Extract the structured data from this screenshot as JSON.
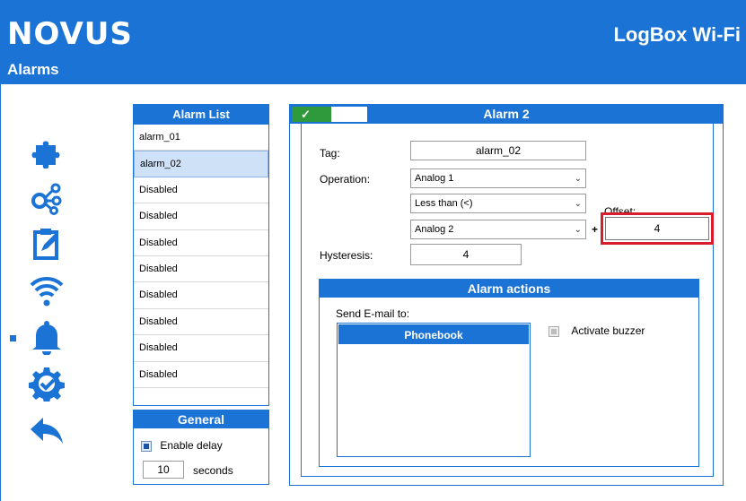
{
  "header": {
    "logo": "NOVUS",
    "product": "LogBox Wi-Fi",
    "page_title": "Alarms"
  },
  "nav": {
    "icons": [
      "puzzle-icon",
      "network-icon",
      "clipboard-icon",
      "wifi-icon",
      "bell-icon",
      "settings-check-icon",
      "back-arrow-icon"
    ],
    "active": "bell-icon",
    "accent": "#1b73d6"
  },
  "alarm_list": {
    "title": "Alarm  List",
    "items": [
      {
        "label": "alarm_01"
      },
      {
        "label": "alarm_02",
        "selected": true
      },
      {
        "label": "Disabled"
      },
      {
        "label": "Disabled"
      },
      {
        "label": "Disabled"
      },
      {
        "label": "Disabled"
      },
      {
        "label": "Disabled"
      },
      {
        "label": "Disabled"
      },
      {
        "label": "Disabled"
      },
      {
        "label": "Disabled"
      }
    ]
  },
  "general": {
    "title": "General",
    "enable_delay_label": "Enable delay",
    "delay_value": "10",
    "delay_unit": "seconds"
  },
  "alarm": {
    "title": "Alarm  2",
    "enabled_mark": "✓",
    "tag_label": "Tag:",
    "tag_value": "alarm_02",
    "operation_label": "Operation:",
    "operation_value": "Analog 1",
    "comparison_value": "Less than (<)",
    "compare_with_value": "Analog 2",
    "plus": "+",
    "offset_label": "Offset:",
    "offset_value": "4",
    "hysteresis_label": "Hysteresis:",
    "hysteresis_value": "4"
  },
  "actions": {
    "title": "Alarm actions",
    "send_email_label": "Send E-mail to:",
    "phonebook_title": "Phonebook",
    "buzzer_label": "Activate buzzer"
  }
}
